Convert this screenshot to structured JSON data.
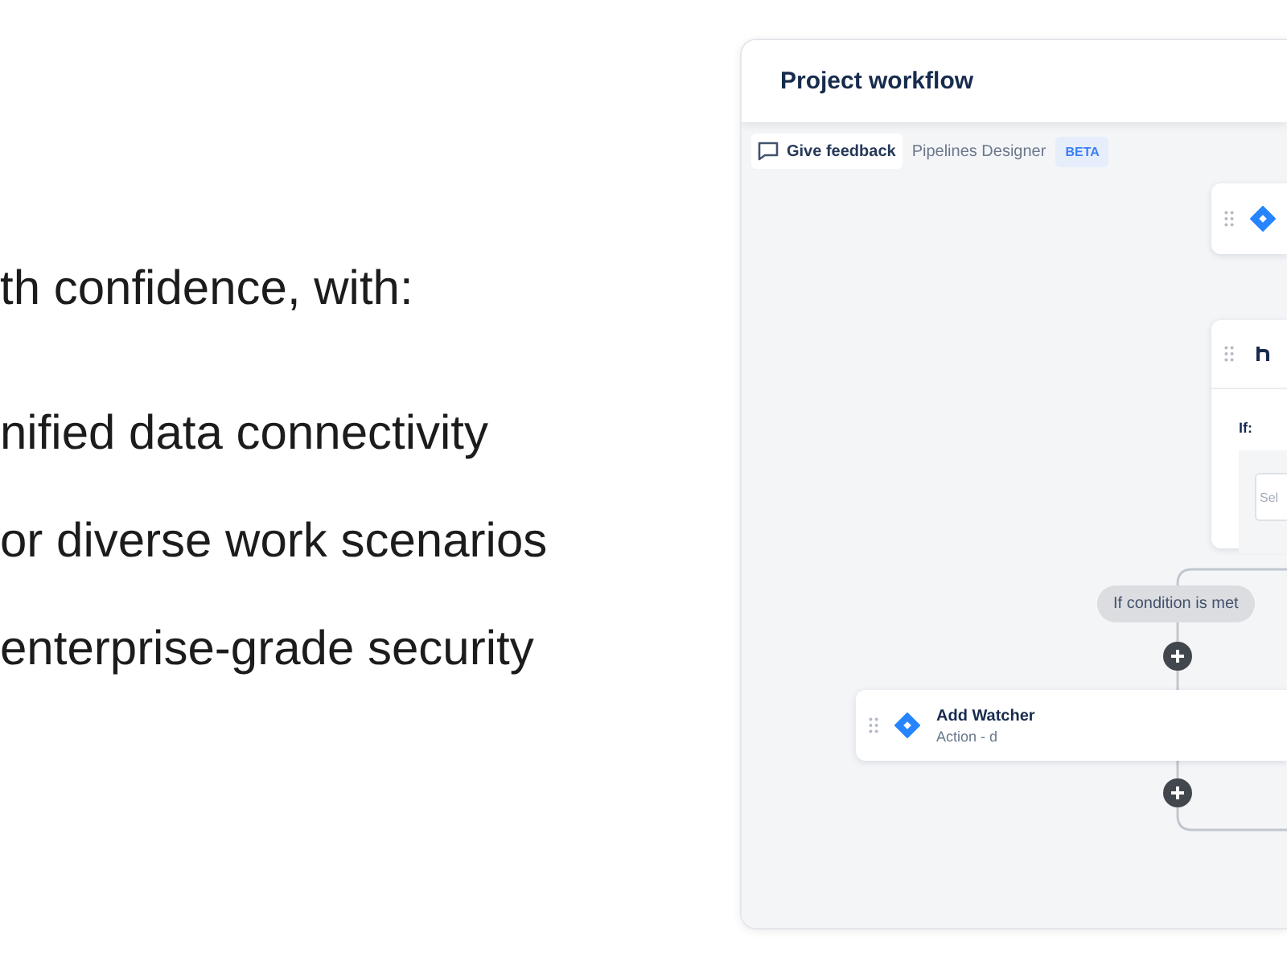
{
  "slide": {
    "heading": "th confidence, with:",
    "features": [
      "nified data connectivity",
      "or diverse work scenarios",
      "enterprise-grade security"
    ]
  },
  "panel": {
    "title": "Project workflow",
    "toolbar": {
      "feedback_button": "Give feedback",
      "label": "Pipelines Designer",
      "badge": "BETA"
    }
  },
  "canvas": {
    "nodes": [
      {
        "kind": "action"
      },
      {
        "kind": "condition",
        "label": "If:",
        "placeholder": "Sel"
      },
      {
        "kind": "action",
        "title": "Add Watcher",
        "subtitle": "Action - d"
      }
    ],
    "branch_label": "If condition is met"
  }
}
